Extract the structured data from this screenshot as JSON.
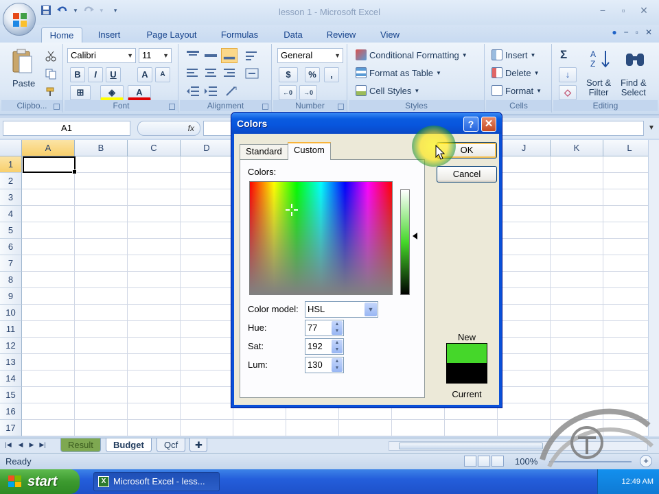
{
  "window": {
    "title": "lesson 1 - Microsoft Excel",
    "min": "−",
    "restore": "▫",
    "close": "✕"
  },
  "ribbon_tabs": [
    "Home",
    "Insert",
    "Page Layout",
    "Formulas",
    "Data",
    "Review",
    "View"
  ],
  "ribbon": {
    "clipboard": {
      "label": "Clipbo...",
      "paste": "Paste"
    },
    "font": {
      "label": "Font",
      "name": "Calibri",
      "size": "11",
      "bold": "B",
      "italic": "I",
      "underline": "U",
      "grow": "A",
      "shrink": "A"
    },
    "alignment": {
      "label": "Alignment"
    },
    "number": {
      "label": "Number",
      "format": "General",
      "currency": "$",
      "percent": "%",
      "comma": ","
    },
    "styles": {
      "label": "Styles",
      "conditional": "Conditional Formatting",
      "format_table": "Format as Table",
      "cell_styles": "Cell Styles"
    },
    "cells": {
      "label": "Cells",
      "insert": "Insert",
      "delete": "Delete",
      "format": "Format"
    },
    "editing": {
      "label": "Editing",
      "sum": "Σ",
      "sort_line1": "Sort &",
      "sort_line2": "Filter",
      "find_line1": "Find &",
      "find_line2": "Select"
    }
  },
  "formula_bar": {
    "name_box": "A1",
    "fx": "fx",
    "formula": ""
  },
  "grid": {
    "columns": [
      "A",
      "B",
      "C",
      "D",
      "E",
      "F",
      "G",
      "H",
      "I",
      "J",
      "K",
      "L"
    ],
    "rows": [
      "1",
      "2",
      "3",
      "4",
      "5",
      "6",
      "7",
      "8",
      "9",
      "10",
      "11",
      "12",
      "13",
      "14",
      "15",
      "16",
      "17"
    ],
    "active_cell": "A1"
  },
  "sheets": [
    "Result",
    "Budget",
    "Qcf"
  ],
  "active_sheet": "Budget",
  "status": {
    "text": "Ready",
    "zoom": "100%"
  },
  "taskbar": {
    "start": "start",
    "task": "Microsoft Excel - less...",
    "clock": "12:49 AM"
  },
  "dialog": {
    "title": "Colors",
    "help": "?",
    "close": "✕",
    "tabs": [
      "Standard",
      "Custom"
    ],
    "active_tab": "Custom",
    "colors_label": "Colors:",
    "color_model_label": "Color model:",
    "color_model": "HSL",
    "hue_label": "Hue:",
    "hue": "77",
    "sat_label": "Sat:",
    "sat": "192",
    "lum_label": "Lum:",
    "lum": "130",
    "ok": "OK",
    "cancel": "Cancel",
    "new_label": "New",
    "current_label": "Current",
    "new_color": "#45d72a",
    "current_color": "#000000"
  },
  "colors": {
    "ribbon_text": "#15428b",
    "dialog_title": "#0a5ce0",
    "active_cell_border": "#000000"
  }
}
